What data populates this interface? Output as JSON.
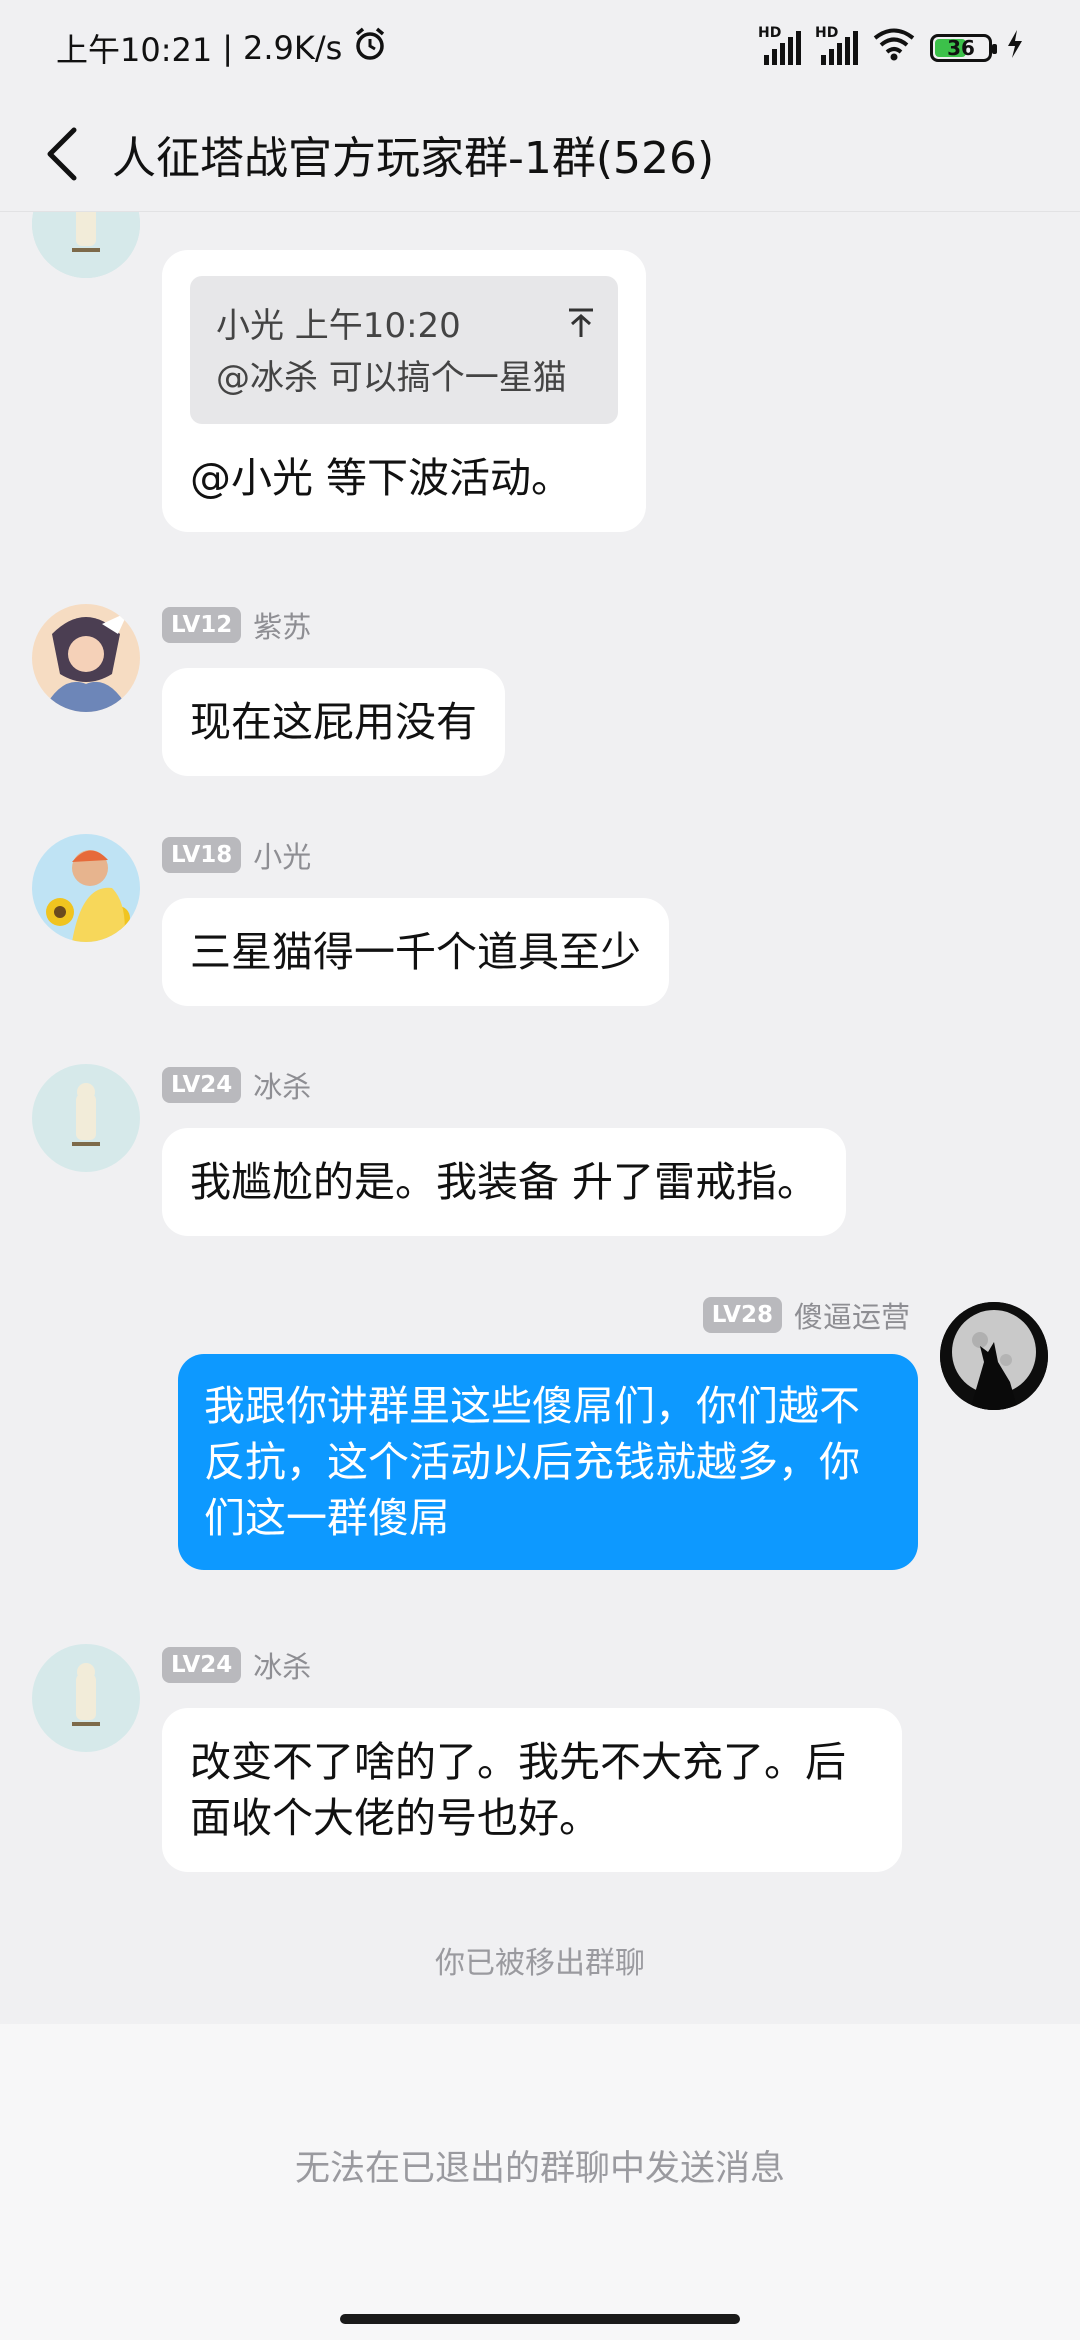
{
  "status": {
    "time": "上午10:21",
    "speed": "2.9K/s",
    "network1": "HD",
    "network2": "HD",
    "battery": "36"
  },
  "header": {
    "title": "人征塔战官方玩家群-1群(526)"
  },
  "messages": [
    {
      "quote_author_time": "小光 上午10:20",
      "quote_text": "@冰杀 可以搞个一星猫",
      "text": "@小光 等下波活动。"
    },
    {
      "level": "LV12",
      "name": "紫苏",
      "text": "现在这屁用没有"
    },
    {
      "level": "LV18",
      "name": "小光",
      "text": "三星猫得一千个道具至少"
    },
    {
      "level": "LV24",
      "name": "冰杀",
      "text": "我尴尬的是。我装备 升了雷戒指。"
    },
    {
      "level": "LV28",
      "name": "傻逼运营",
      "text": "我跟你讲群里这些傻屌们，你们越不反抗，这个活动以后充钱就越多，你们这一群傻屌"
    },
    {
      "level": "LV24",
      "name": "冰杀",
      "text": "改变不了啥的了。我先不大充了。后面收个大佬的号也好。"
    }
  ],
  "system_note": "你已被移出群聊",
  "footer": {
    "notice": "无法在已退出的群聊中发送消息"
  },
  "colors": {
    "outgoing_bubble": "#0d99ff",
    "incoming_bubble": "#ffffff",
    "background": "#f0f0f2"
  }
}
